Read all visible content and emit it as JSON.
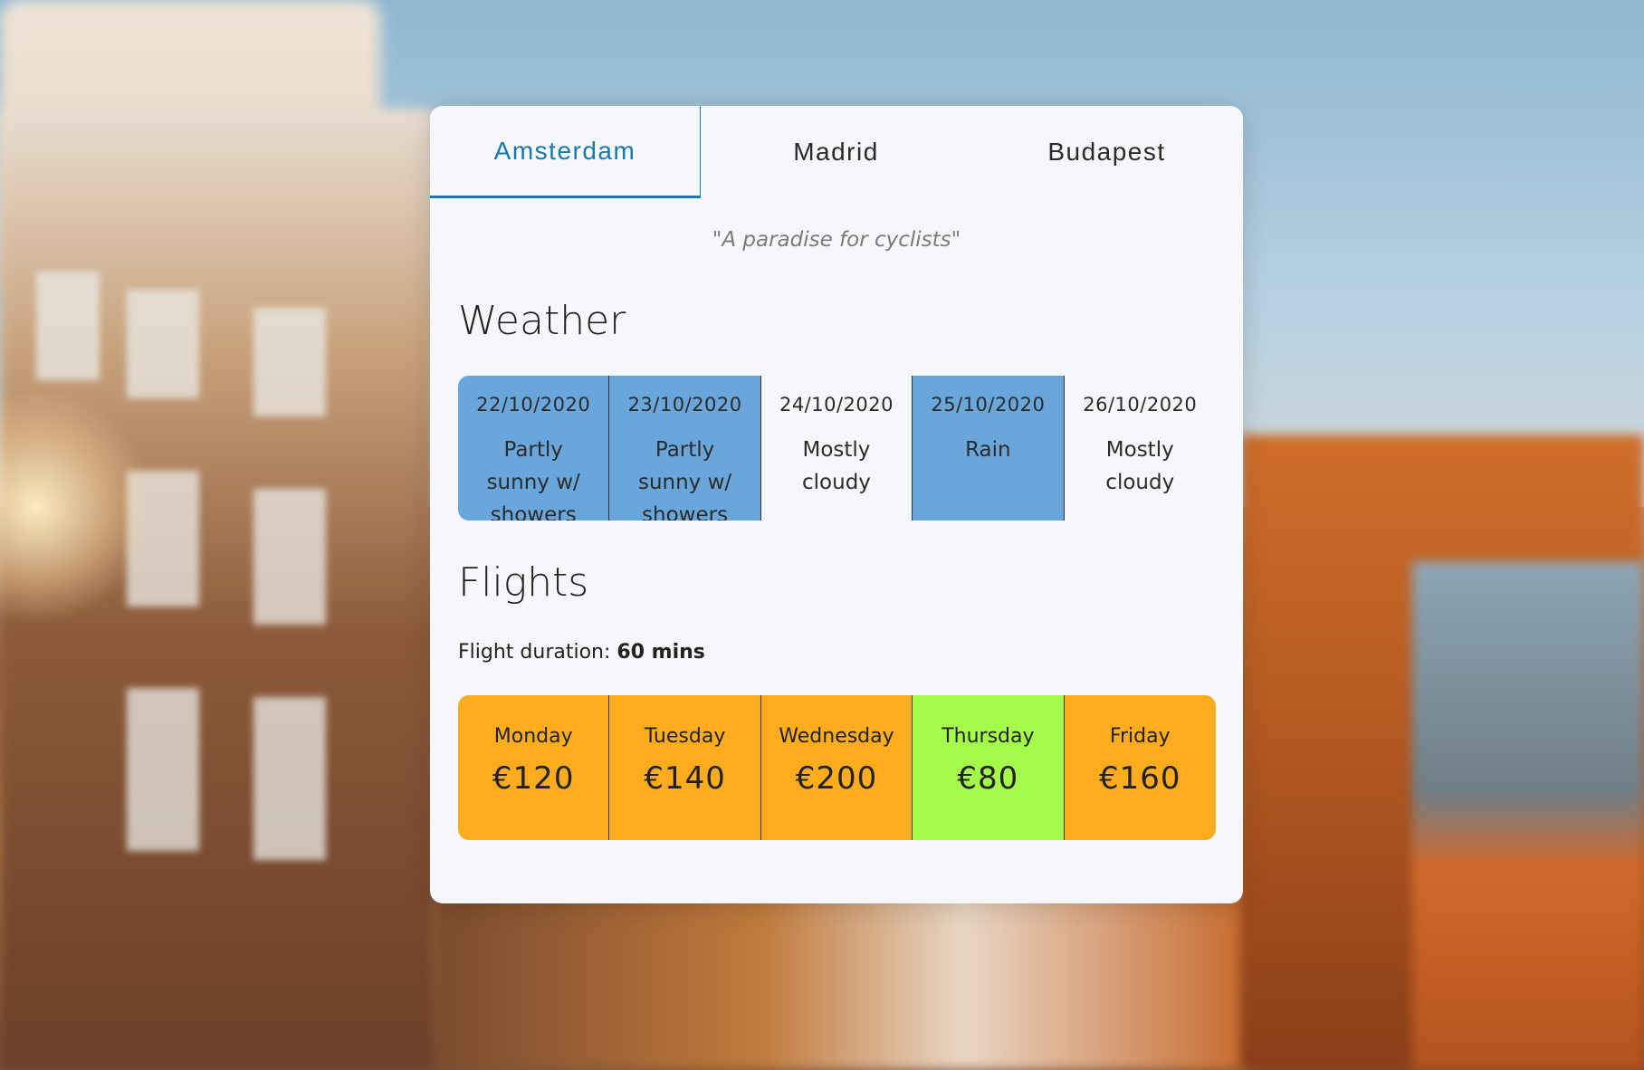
{
  "tabs": [
    {
      "label": "Amsterdam",
      "active": true
    },
    {
      "label": "Madrid",
      "active": false
    },
    {
      "label": "Budapest",
      "active": false
    }
  ],
  "quote": "\"A paradise for cyclists\"",
  "weather": {
    "title": "Weather",
    "days": [
      {
        "date": "22/10/2020",
        "desc": "Partly sunny w/ showers",
        "highlight": true
      },
      {
        "date": "23/10/2020",
        "desc": "Partly sunny w/ showers",
        "highlight": true
      },
      {
        "date": "24/10/2020",
        "desc": "Mostly cloudy",
        "highlight": false
      },
      {
        "date": "25/10/2020",
        "desc": "Rain",
        "highlight": true
      },
      {
        "date": "26/10/2020",
        "desc": "Mostly cloudy",
        "highlight": false
      }
    ]
  },
  "flights": {
    "title": "Flights",
    "duration_label": "Flight duration:",
    "duration_value": "60 mins",
    "days": [
      {
        "day": "Monday",
        "price": "€120"
      },
      {
        "day": "Tuesday",
        "price": "€140"
      },
      {
        "day": "Wednesday",
        "price": "€200"
      },
      {
        "day": "Thursday",
        "price": "€80"
      },
      {
        "day": "Friday",
        "price": "€160"
      }
    ]
  },
  "colors": {
    "accent": "#1a78ad",
    "weather_highlight": "#68a6db",
    "flight_default": "#fcac1d",
    "flight_cheapest": "#a4fb49",
    "card_bg": "#f6f7fb"
  }
}
